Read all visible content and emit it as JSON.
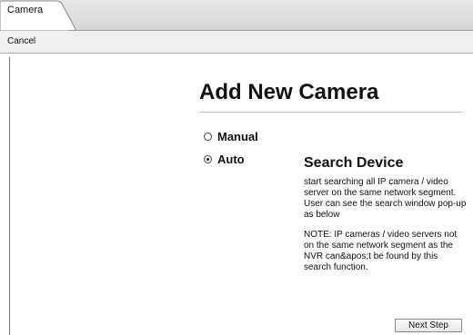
{
  "tab": {
    "label": "Camera"
  },
  "toolbar": {
    "cancel_label": "Cancel"
  },
  "main": {
    "title": "Add New Camera",
    "options": [
      {
        "label": "Manual",
        "checked": false
      },
      {
        "label": "Auto",
        "checked": true
      }
    ],
    "description": {
      "title": "Search Device",
      "text": "start searching all IP camera / video server on the same network segment. User can see the search window pop-up as below",
      "note": "NOTE: IP cameras / video servers not on the same network segment as the NVR can&apos;t be found by this search function."
    },
    "next_button_label": "Next Step"
  }
}
